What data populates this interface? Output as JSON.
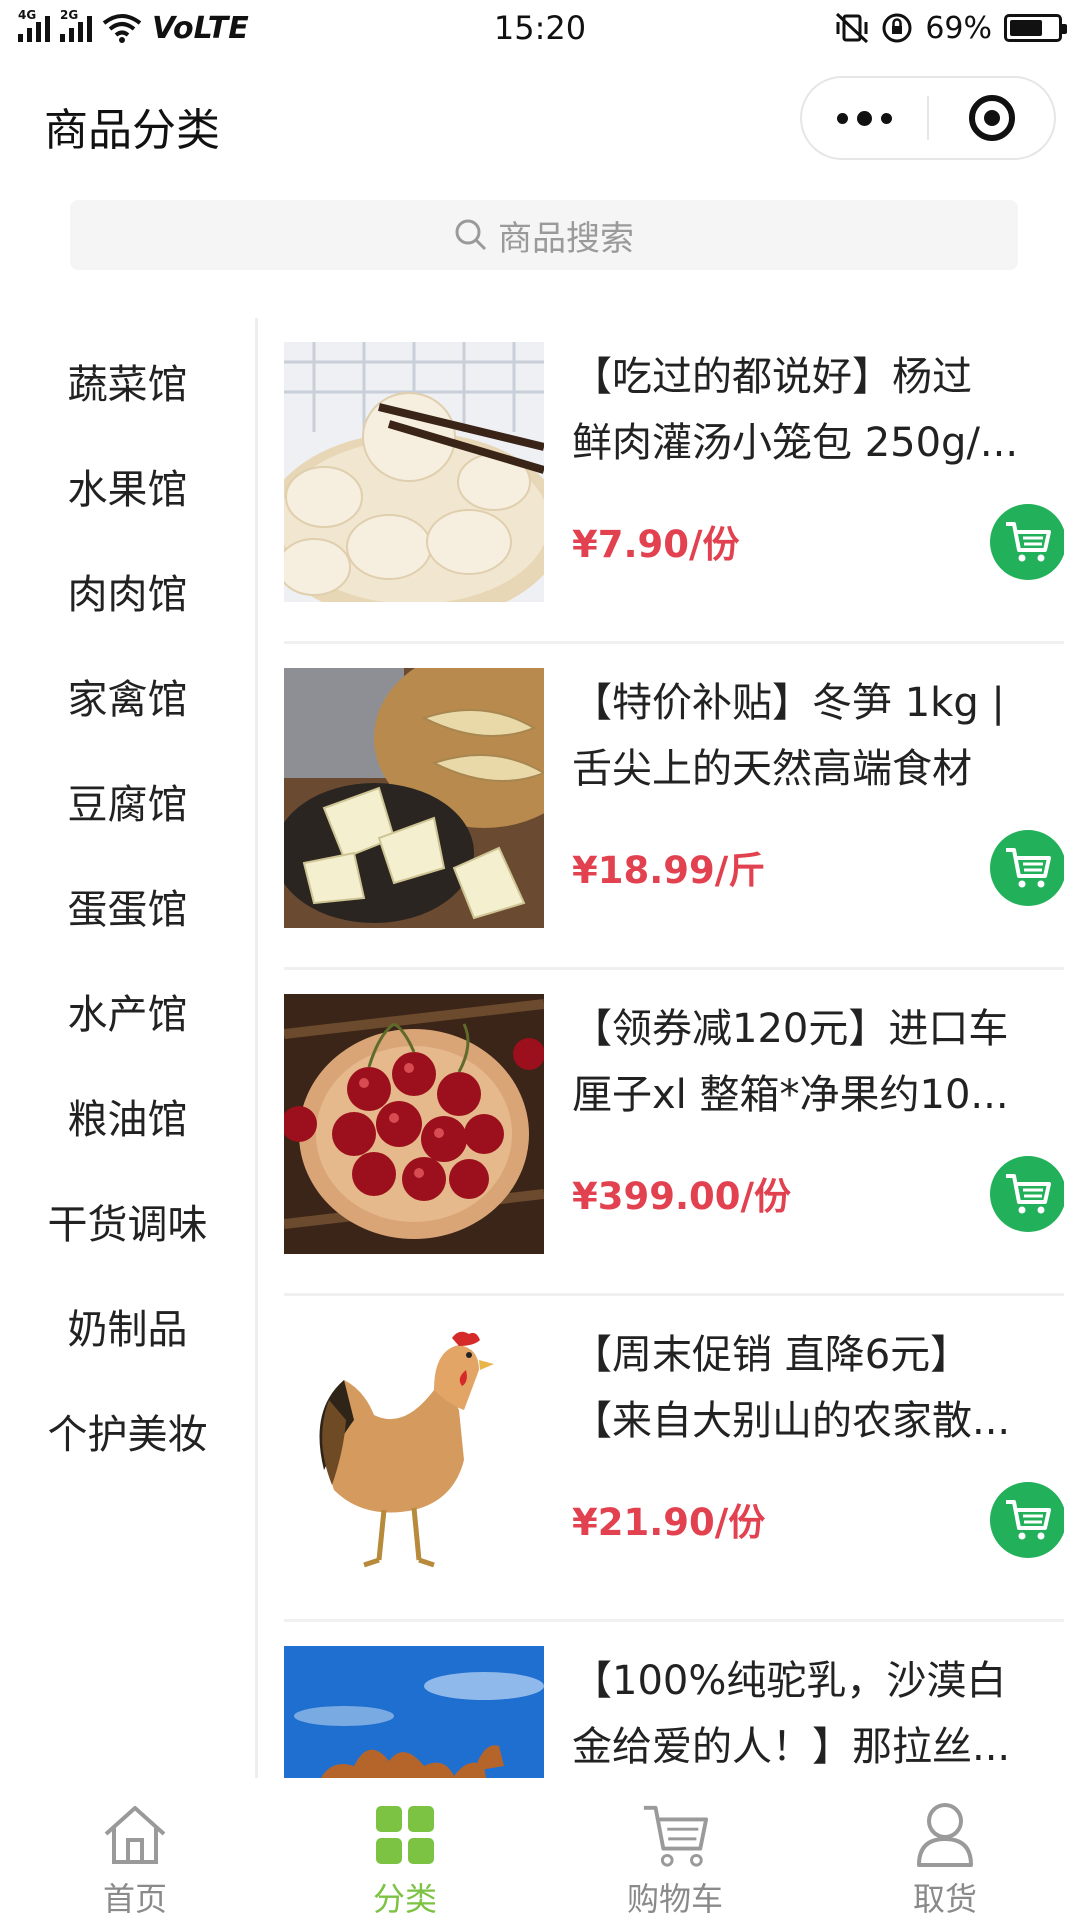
{
  "status_bar": {
    "network_a": "4G",
    "network_b": "2G",
    "volte": "VoLTE",
    "time": "15:20",
    "battery": "69%",
    "battery_level": 0.69
  },
  "header": {
    "title": "商品分类"
  },
  "search": {
    "placeholder": "商品搜索"
  },
  "sidebar": {
    "items": [
      {
        "label": "蔬菜馆"
      },
      {
        "label": "水果馆"
      },
      {
        "label": "肉肉馆"
      },
      {
        "label": "家禽馆"
      },
      {
        "label": "豆腐馆"
      },
      {
        "label": "蛋蛋馆"
      },
      {
        "label": "水产馆"
      },
      {
        "label": "粮油馆"
      },
      {
        "label": "干货调味"
      },
      {
        "label": "奶制品"
      },
      {
        "label": "个护美妆"
      }
    ]
  },
  "products": [
    {
      "title_line1": "【吃过的都说好】杨过",
      "title_line2": "鲜肉灌汤小笼包 250g/...",
      "price": "¥7.90/份",
      "image": "soup-dumplings"
    },
    {
      "title_line1": "【特价补贴】冬笋 1kg |",
      "title_line2": "舌尖上的天然高端食材",
      "price": "¥18.99/斤",
      "image": "winter-bamboo-shoots"
    },
    {
      "title_line1": "【领券减120元】进口车",
      "title_line2": "厘子xl 整箱*净果约10...",
      "price": "¥399.00/份",
      "image": "cherries"
    },
    {
      "title_line1": "【周末促销 直降6元】",
      "title_line2": "【来自大别山的农家散...",
      "price": "¥21.90/份",
      "image": "free-range-chicken"
    },
    {
      "title_line1": "【100%纯驼乳，沙漠白",
      "title_line2": "金给爱的人！】那拉丝...",
      "price": "",
      "image": "camel-desert"
    }
  ],
  "tabbar": {
    "tabs": [
      {
        "label": "首页",
        "icon": "home-icon"
      },
      {
        "label": "分类",
        "icon": "category-grid-icon"
      },
      {
        "label": "购物车",
        "icon": "cart-icon"
      },
      {
        "label": "取货",
        "icon": "user-icon"
      }
    ],
    "active": "分类"
  },
  "colors": {
    "accent_green": "#22b05a",
    "tab_active": "#7cc243",
    "price_red": "#e2414f"
  }
}
